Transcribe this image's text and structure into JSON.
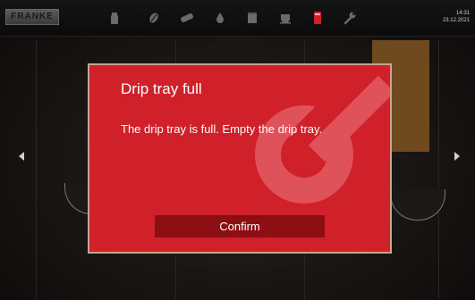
{
  "brand": {
    "logo_text": "FRANKE"
  },
  "status": {
    "time": "14:31",
    "date": "23.12.2021"
  },
  "toolbar": {
    "icons": [
      "bean-container-icon",
      "coffee-bean-icon",
      "milk-icon",
      "water-drop-icon",
      "grounds-bin-icon",
      "cup-icon",
      "drip-tray-icon",
      "wrench-icon"
    ],
    "active_icon": "drip-tray-icon",
    "accent_color": "#d0212a"
  },
  "dialog": {
    "title": "Drip tray full",
    "message": "The drip tray is full. Empty the drip tray.",
    "confirm_label": "Confirm",
    "background_color": "#d0212a",
    "button_color": "#8d0f13"
  }
}
